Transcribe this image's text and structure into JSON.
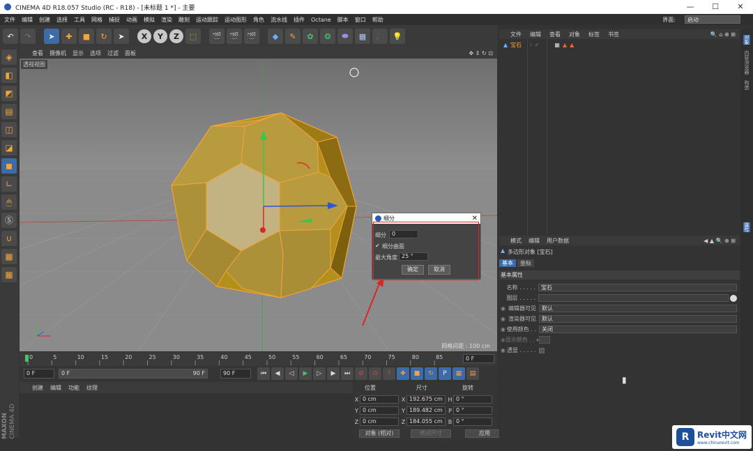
{
  "window": {
    "title": "CINEMA 4D R18.057 Studio (RC - R18) - [未标题 1 *] - 主要",
    "min": "—",
    "max": "☐",
    "close": "✕"
  },
  "menu": {
    "items": [
      "文件",
      "编辑",
      "创建",
      "选择",
      "工具",
      "网格",
      "捕捉",
      "动画",
      "模拟",
      "渲染",
      "雕刻",
      "运动跟踪",
      "运动图形",
      "角色",
      "流水线",
      "插件",
      "Octane",
      "脚本",
      "窗口",
      "帮助"
    ],
    "interface_label": "界面:",
    "interface_value": "启动"
  },
  "viewport": {
    "menu": [
      "查看",
      "摄像机",
      "显示",
      "选项",
      "过滤",
      "面板"
    ],
    "name": "透视视图",
    "grid_info": "网格间距 : 100 cm"
  },
  "timeline": {
    "ticks": [
      "0",
      "5",
      "10",
      "15",
      "20",
      "25",
      "30",
      "35",
      "40",
      "45",
      "50",
      "55",
      "60",
      "65",
      "70",
      "75",
      "80",
      "85",
      "90"
    ],
    "frame_display": "0 F",
    "current": "0 F",
    "start": "0 F",
    "end_slider": "90 F",
    "end": "90 F"
  },
  "material": {
    "menu": [
      "创建",
      "编辑",
      "功能",
      "纹理"
    ]
  },
  "coords": {
    "headers": [
      "位置",
      "尺寸",
      "旋转"
    ],
    "rows": [
      {
        "a": "X",
        "pos": "0 cm",
        "b": "X",
        "size": "192.675 cm",
        "c": "H",
        "rot": "0 °"
      },
      {
        "a": "Y",
        "pos": "0 cm",
        "b": "Y",
        "size": "189.482 cm",
        "c": "P",
        "rot": "0 °"
      },
      {
        "a": "Z",
        "pos": "0 cm",
        "b": "Z",
        "size": "184.055 cm",
        "c": "B",
        "rot": "0 °"
      }
    ],
    "mode": "对象 (相对)",
    "size_mode": "绝对尺寸",
    "apply": "应用"
  },
  "objects": {
    "menu": [
      "文件",
      "编辑",
      "查看",
      "对象",
      "标签",
      "书签"
    ],
    "items": [
      {
        "name": "宝石"
      }
    ]
  },
  "attributes": {
    "menu": [
      "模式",
      "编辑",
      "用户数据"
    ],
    "title": "多边形对象 [宝石]",
    "tabs": [
      "基本",
      "坐标"
    ],
    "section": "基本属性",
    "name_label": "名称 . . . . .",
    "name_value": "宝石",
    "layer_label": "图层 . . . . .",
    "layer_value": "",
    "editor_vis_label": "编辑器可见",
    "editor_vis_value": "默认",
    "render_vis_label": "渲染器可见",
    "render_vis_value": "默认",
    "use_color_label": "使用颜色 . .",
    "use_color_value": "关闭",
    "display_color_label": "显示颜色 . . ▸",
    "transparent_label": "透显 . . . . ."
  },
  "sidetabs": [
    "对象",
    "内容浏览器",
    "构造",
    "属性"
  ],
  "dialog": {
    "title": "细分",
    "subdivision_label": "细分",
    "subdivision_value": "0",
    "smooth_label": "细分曲面",
    "max_angle_label": "最大角度",
    "max_angle_value": "25 °",
    "ok": "确定",
    "cancel": "取消"
  },
  "watermark": {
    "logo": "R",
    "text": "Revit中文网",
    "url": "www.chinarevit.com"
  },
  "brand": {
    "maxon": "MAXON",
    "c4d": "CINEMA 4D"
  },
  "colors": {
    "accent_orange": "#f3a43a",
    "selection_blue": "#3d6aa8",
    "annotation_red": "#d62828"
  }
}
